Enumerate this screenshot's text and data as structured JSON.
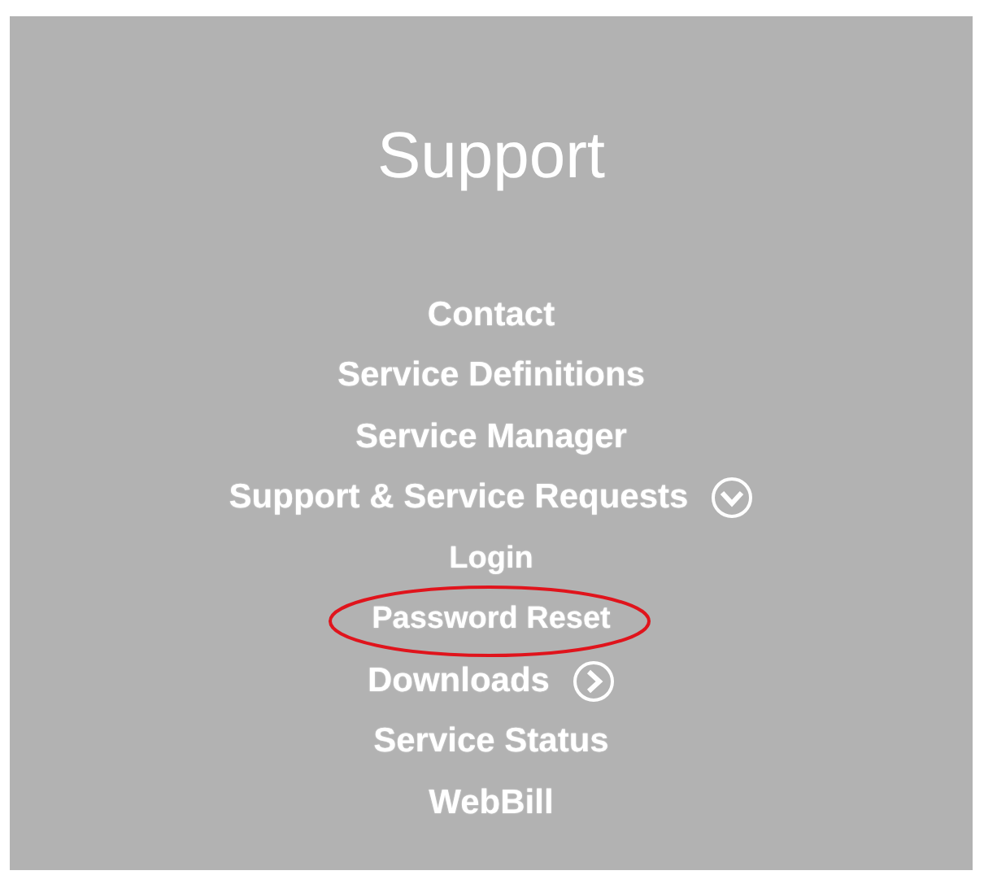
{
  "title": "Support",
  "menu": [
    {
      "label": "Contact"
    },
    {
      "label": "Service Definitions"
    },
    {
      "label": "Service Manager"
    },
    {
      "label": "Support & Service Requests",
      "expanded": true,
      "children": [
        {
          "label": "Login",
          "circled": false
        },
        {
          "label": "Password Reset",
          "circled": true
        }
      ]
    },
    {
      "label": "Downloads",
      "expanded": false
    },
    {
      "label": "Service Status"
    },
    {
      "label": "WebBill"
    }
  ]
}
